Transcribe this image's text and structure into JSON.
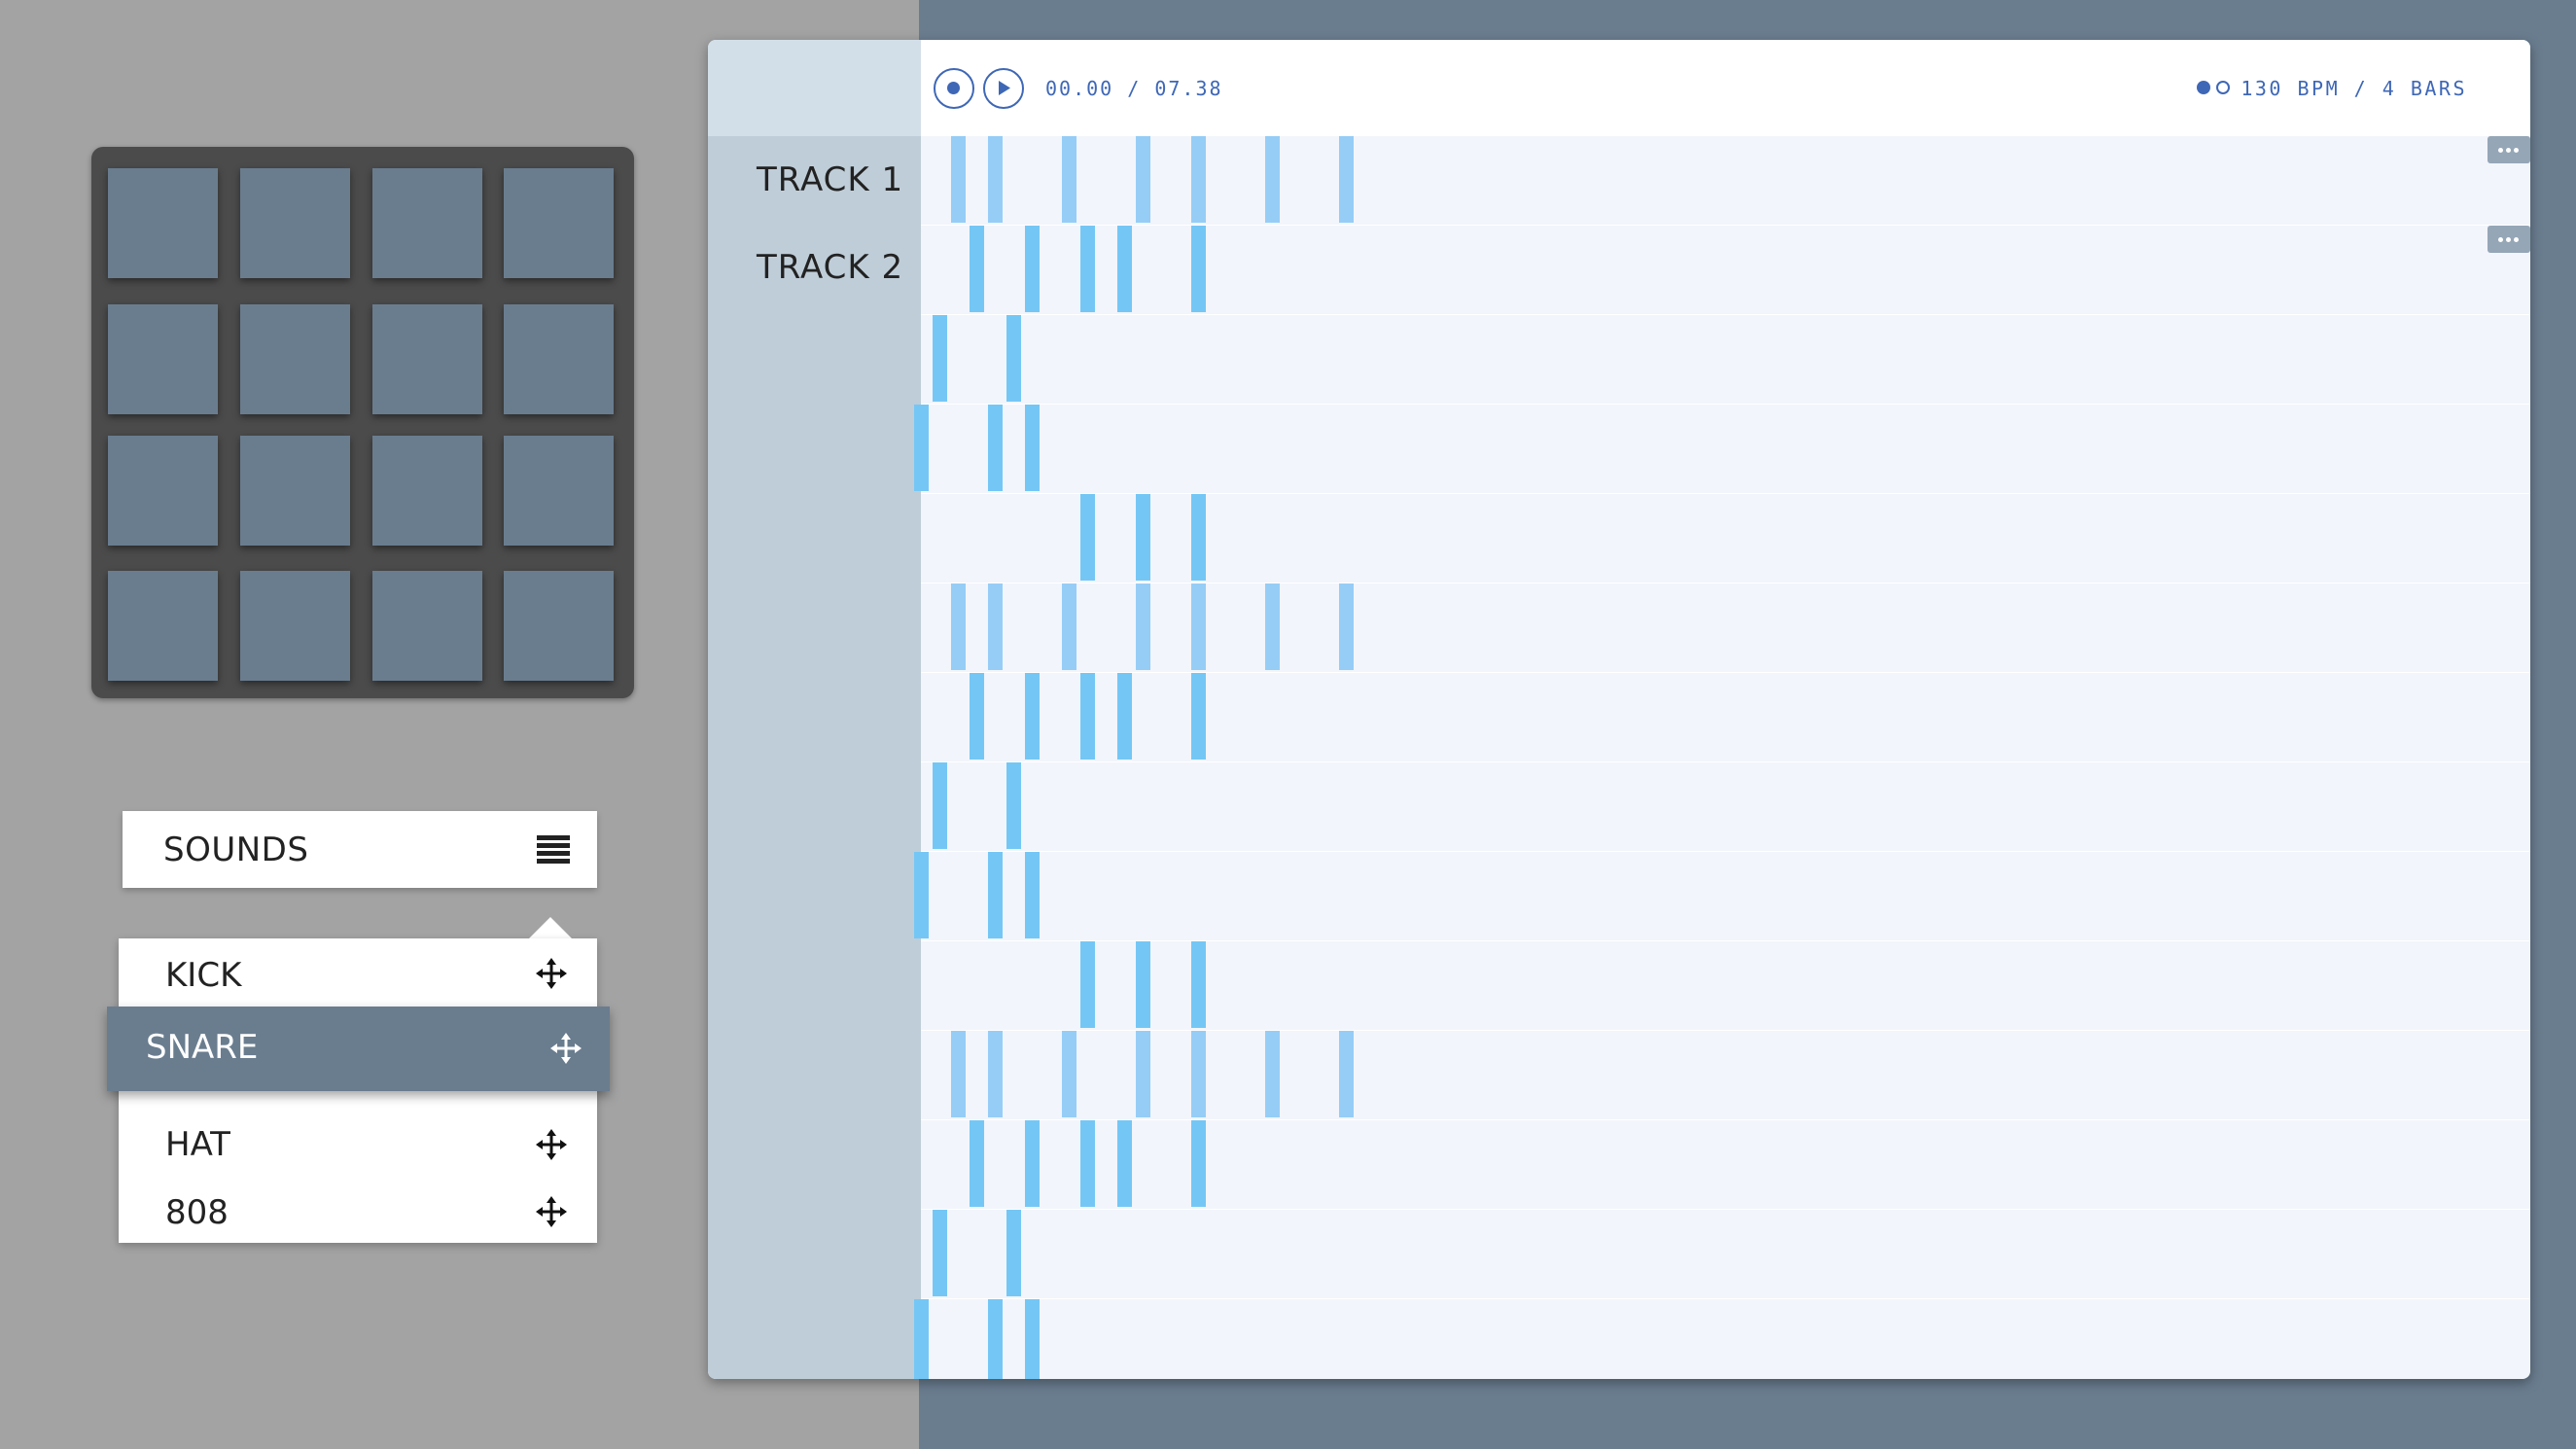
{
  "colors": {
    "pad": "#6a7d8f",
    "pad_frame": "#4b4b4b",
    "step": "#74c7f5",
    "accent": "#3e67b6",
    "selected_item": "#6a7d8f"
  },
  "drum_pad": {
    "rows": 4,
    "cols": 4
  },
  "sounds": {
    "title": "SOUNDS",
    "menu_icon": "hamburger-menu-icon",
    "items": [
      {
        "label": "KICK",
        "icon": "move-icon"
      },
      {
        "label": "SNARE",
        "icon": "move-icon",
        "selected": true
      },
      {
        "label": "HAT",
        "icon": "move-icon"
      },
      {
        "label": "808",
        "icon": "move-icon"
      }
    ]
  },
  "sequencer": {
    "record_icon": "record-icon",
    "play_icon": "play-icon",
    "time": "00.00 / 07.38",
    "mode_icon": "toggle-dots-icon",
    "tempo": "130 BPM / 4 BARS",
    "tracks": [
      {
        "label": "TRACK 1"
      },
      {
        "label": "TRACK 2"
      }
    ],
    "more_icon": "more-icon"
  }
}
